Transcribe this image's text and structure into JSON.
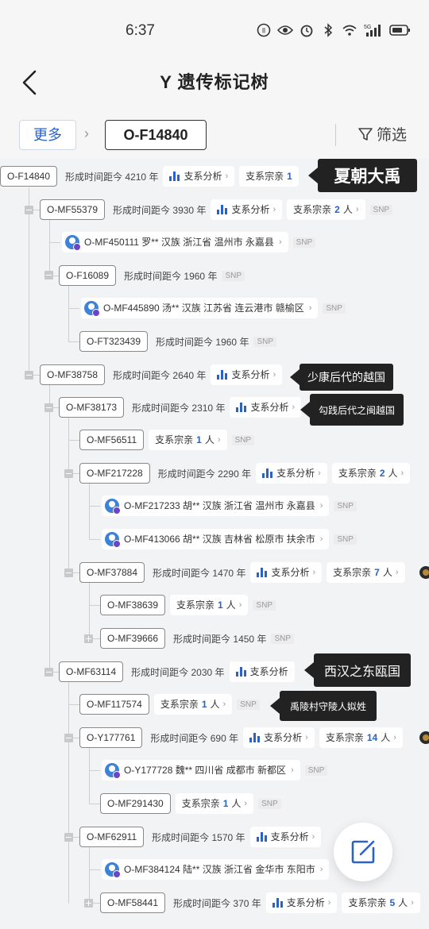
{
  "status_bar": {
    "time": "6:37",
    "network": "5G"
  },
  "header": {
    "title": "Y 遗传标记树"
  },
  "crumbs": {
    "more": "更多",
    "current": "O-F14840",
    "filter": "筛选"
  },
  "labels": {
    "age_prefix": "形成时间距今",
    "year": "年",
    "branch": "支系分析",
    "clan": "支系宗亲",
    "people": "人",
    "snp": "SNP"
  },
  "nodes": {
    "n1": {
      "id": "O-F14840",
      "age": "4210"
    },
    "n2": {
      "id": "O-MF55379",
      "age": "3930",
      "clan_count": "2"
    },
    "n2p": {
      "text": "O-MF450111 罗** 汉族 浙江省 温州市 永嘉县"
    },
    "n3": {
      "id": "O-F16089",
      "age": "1960"
    },
    "n3p": {
      "text": "O-MF445890 汤** 汉族 江苏省 连云港市 赣榆区"
    },
    "n4": {
      "id": "O-FT323439",
      "age": "1960"
    },
    "n5": {
      "id": "O-MF38758",
      "age": "2640"
    },
    "n6": {
      "id": "O-MF38173",
      "age": "2310"
    },
    "n7": {
      "id": "O-MF56511",
      "clan_count": "1"
    },
    "n8": {
      "id": "O-MF217228",
      "age": "2290",
      "clan_count": "2"
    },
    "n8p1": {
      "text": "O-MF217233 胡** 汉族 浙江省 温州市 永嘉县"
    },
    "n8p2": {
      "text": "O-MF413066 胡** 汉族 吉林省 松原市 扶余市"
    },
    "n9": {
      "id": "O-MF37884",
      "age": "1470",
      "clan_count": "7"
    },
    "n10": {
      "id": "O-MF38639",
      "clan_count": "1"
    },
    "n11": {
      "id": "O-MF39666",
      "age": "1450"
    },
    "n12": {
      "id": "O-MF63114",
      "age": "2030"
    },
    "n13": {
      "id": "O-MF117574",
      "clan_count": "1"
    },
    "n14": {
      "id": "O-Y177761",
      "age": "690",
      "clan_count": "14"
    },
    "n14p": {
      "text": "O-Y177728 魏** 四川省 成都市 新都区"
    },
    "n15": {
      "id": "O-MF291430",
      "clan_count": "1"
    },
    "n16": {
      "id": "O-MF62911",
      "age": "1570"
    },
    "n16p": {
      "text": "O-MF384124 陆** 汉族 浙江省 金华市 东阳市"
    },
    "n17": {
      "id": "O-MF58441",
      "age": "370",
      "clan_count": "5"
    }
  },
  "annotations": {
    "a1": "夏朝大禹",
    "a2": "少康后代的越国",
    "a3": "勾践后代之闽越国",
    "a4": "西汉之东瓯国",
    "a5": "禹陵村守陵人姒姓"
  },
  "colors": {
    "accent": "#2a62c9",
    "tag_bg": "#222222",
    "avatar": "#3d82d9"
  }
}
